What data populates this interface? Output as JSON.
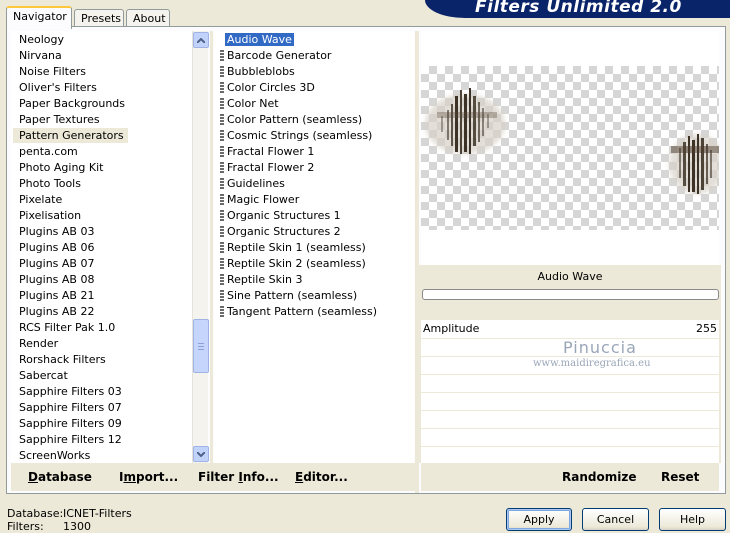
{
  "app": {
    "title": "Filters Unlimited 2.0"
  },
  "tabs": [
    {
      "label": "Navigator",
      "active": true
    },
    {
      "label": "Presets",
      "active": false
    },
    {
      "label": "About",
      "active": false
    }
  ],
  "categories": {
    "items": [
      "Neology",
      "Nirvana",
      "Noise Filters",
      "Oliver's Filters",
      "Paper Backgrounds",
      "Paper Textures",
      "Pattern Generators",
      "penta.com",
      "Photo Aging Kit",
      "Photo Tools",
      "Pixelate",
      "Pixelisation",
      "Plugins AB 03",
      "Plugins AB 06",
      "Plugins AB 07",
      "Plugins AB 08",
      "Plugins AB 21",
      "Plugins AB 22",
      "RCS Filter Pak 1.0",
      "Render",
      "Rorshack Filters",
      "Sabercat",
      "Sapphire Filters 03",
      "Sapphire Filters 07",
      "Sapphire Filters 09",
      "Sapphire Filters 12",
      "ScreenWorks"
    ],
    "selected": "Pattern Generators"
  },
  "filters": {
    "items": [
      "Audio Wave",
      "Barcode Generator",
      "Bubbleblobs",
      "Color Circles 3D",
      "Color Net",
      "Color Pattern (seamless)",
      "Cosmic Strings (seamless)",
      "Fractal Flower 1",
      "Fractal Flower 2",
      "Guidelines",
      "Magic Flower",
      "Organic Structures 1",
      "Organic Structures 2",
      "Reptile Skin 1 (seamless)",
      "Reptile Skin 2 (seamless)",
      "Reptile Skin 3",
      "Sine Pattern (seamless)",
      "Tangent Pattern (seamless)"
    ],
    "selected": "Audio Wave"
  },
  "left_buttons": {
    "database": {
      "ul": "D",
      "rest": "atabase"
    },
    "import": {
      "pre": "I",
      "ul": "m",
      "rest": "port..."
    },
    "filter_info": {
      "pre": "Filter ",
      "ul": "I",
      "rest": "nfo..."
    },
    "editor": {
      "ul": "E",
      "rest": "ditor..."
    }
  },
  "preview": {
    "filter_name": "Audio Wave"
  },
  "parameters": [
    {
      "name": "Amplitude",
      "value": "255"
    }
  ],
  "watermark": {
    "line1": "Pinuccia",
    "line2": "www.maidiregrafica.eu"
  },
  "right_buttons": {
    "randomize": "Randomize",
    "reset": "Reset"
  },
  "footer": {
    "database_label": "Database:",
    "database_value": "ICNET-Filters",
    "filters_label": "Filters:",
    "filters_value": "1300"
  },
  "dialog_buttons": {
    "apply": "Apply",
    "cancel": "Cancel",
    "help": "Help"
  },
  "colors": {
    "banner": "#0a246a",
    "selection": "#316ac5",
    "window": "#ece9d8"
  }
}
